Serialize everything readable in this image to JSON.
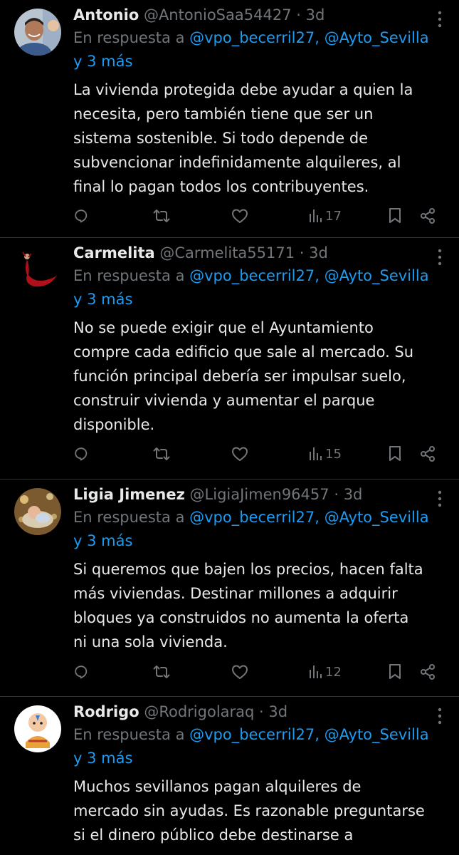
{
  "tweets": [
    {
      "name": "Antonio",
      "handle": "@AntonioSaa54427",
      "separator": "·",
      "time": "3d",
      "reply_prefix": "En respuesta a ",
      "mentions": "@vpo_becerril27, @Ayto_Sevilla",
      "reply_more": "y 3 más",
      "lines": [
        "La vivienda protegida debe ayudar a quien la",
        "necesita, pero también tiene que ser un",
        "sistema sostenible. Si todo depende de",
        "subvencionar indefinidamente alquileres, al",
        "final lo pagan todos los contribuyentes."
      ],
      "views": "17"
    },
    {
      "name": "Carmelita",
      "handle": "@Carmelita55171",
      "separator": "·",
      "time": "3d",
      "reply_prefix": "En respuesta a ",
      "mentions": "@vpo_becerril27, @Ayto_Sevilla",
      "reply_more": "y 3 más",
      "lines": [
        "No se puede exigir que el Ayuntamiento",
        "compre cada edificio que sale al mercado. Su",
        "función principal debería ser impulsar suelo,",
        "construir vivienda y aumentar el parque",
        "disponible."
      ],
      "views": "15"
    },
    {
      "name": "Ligia Jimenez",
      "handle": "@LigiaJimen96457",
      "separator": "·",
      "time": "3d",
      "reply_prefix": "En respuesta a ",
      "mentions": "@vpo_becerril27, @Ayto_Sevilla",
      "reply_more": "y 3 más",
      "lines": [
        "Si queremos que bajen los precios, hacen falta",
        "más viviendas. Destinar millones a adquirir",
        "bloques ya construidos no aumenta la oferta",
        "ni una sola vivienda."
      ],
      "views": "12"
    },
    {
      "name": "Rodrigo",
      "handle": "@Rodrigolaraq",
      "separator": "·",
      "time": "3d",
      "reply_prefix": "En respuesta a ",
      "mentions": "@vpo_becerril27, @Ayto_Sevilla",
      "reply_more": "y 3 más",
      "lines": [
        "Muchos sevillanos pagan alquileres de",
        "mercado sin ayudas. Es razonable preguntarse",
        "si el dinero público debe destinarse a"
      ]
    }
  ],
  "icons": {
    "reply": "reply-icon",
    "retweet": "retweet-icon",
    "like": "like-icon",
    "views": "views-icon",
    "bookmark": "bookmark-icon",
    "share": "share-icon",
    "more": "more-options-icon"
  },
  "colors": {
    "background": "#000000",
    "text": "#e7e9ea",
    "secondary": "#71767b",
    "link": "#1d9bf0",
    "divider": "#2f3336"
  }
}
